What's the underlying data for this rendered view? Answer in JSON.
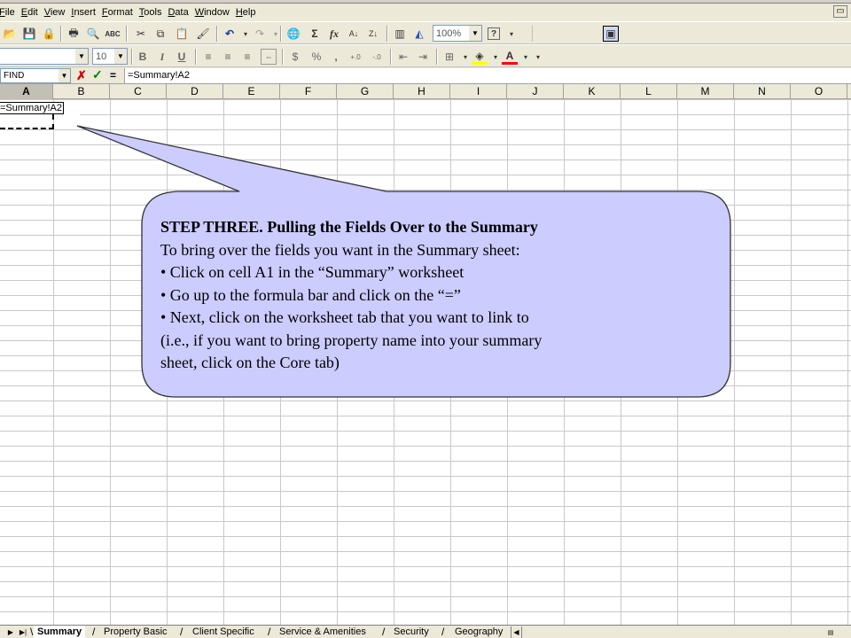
{
  "menu": [
    "File",
    "Edit",
    "View",
    "Insert",
    "Format",
    "Tools",
    "Data",
    "Window",
    "Help"
  ],
  "toolbar": {
    "zoom": "100%",
    "font_size": "10",
    "icons": [
      "open-icon",
      "save-icon",
      "permission-icon",
      "print-icon",
      "print-preview-icon",
      "spelling-icon",
      "cut-icon",
      "copy-icon",
      "paste-icon",
      "format-painter-icon",
      "undo-icon",
      "redo-icon",
      "hyperlink-icon",
      "autosum-icon",
      "function-icon",
      "sort-ascending-icon",
      "sort-descending-icon",
      "chart-wizard-icon",
      "drawing-icon",
      "help-icon"
    ],
    "glyphs": {
      "open": "📂",
      "save": "💾",
      "permission": "🔒",
      "print": "🖶",
      "preview": "🔍",
      "spell": "ABC",
      "cut": "✂",
      "copy": "⧉",
      "paste": "📋",
      "painter": "🖌",
      "undo": "↶",
      "redo": "↷",
      "hyperlink": "🌐",
      "sum": "Σ",
      "fx": "fx",
      "sort_az": "A↓",
      "sort_za": "Z↓",
      "chart": "▥",
      "draw": "◭",
      "help": "?",
      "bold": "B",
      "italic": "I",
      "underline": "U",
      "currency": "$",
      "percent": "%",
      "comma": ",",
      "inc_decimal": "+.0",
      "dec_decimal": "-.0",
      "fill_color": "◈",
      "font_color": "A"
    }
  },
  "formula_bar": {
    "name_box": "FIND",
    "cancel": "✗",
    "enter": "✓",
    "equals": "=",
    "value": "=Summary!A2"
  },
  "columns": [
    "A",
    "B",
    "C",
    "D",
    "E",
    "F",
    "G",
    "H",
    "I",
    "J",
    "K",
    "L",
    "M",
    "N",
    "O"
  ],
  "cell_a1": "=Summary!A2",
  "sheet_tabs": [
    "Summary",
    "Property Basic",
    "Client Specific",
    "Service & Amenities",
    "Security",
    "Geography"
  ],
  "callout": {
    "title": "STEP THREE.  Pulling the Fields Over to the Summary",
    "lines": [
      "To bring over the fields you want in the Summary sheet:",
      "•  Click on cell A1 in the “Summary”  worksheet",
      "•  Go up to the formula bar and click on the “=”",
      "•  Next, click on the worksheet tab that you want to link to",
      "(i.e.,  if you want to bring property name into your summary",
      "sheet, click on the Core tab)"
    ],
    "fill": "#ccccff",
    "stroke": "#333333"
  }
}
